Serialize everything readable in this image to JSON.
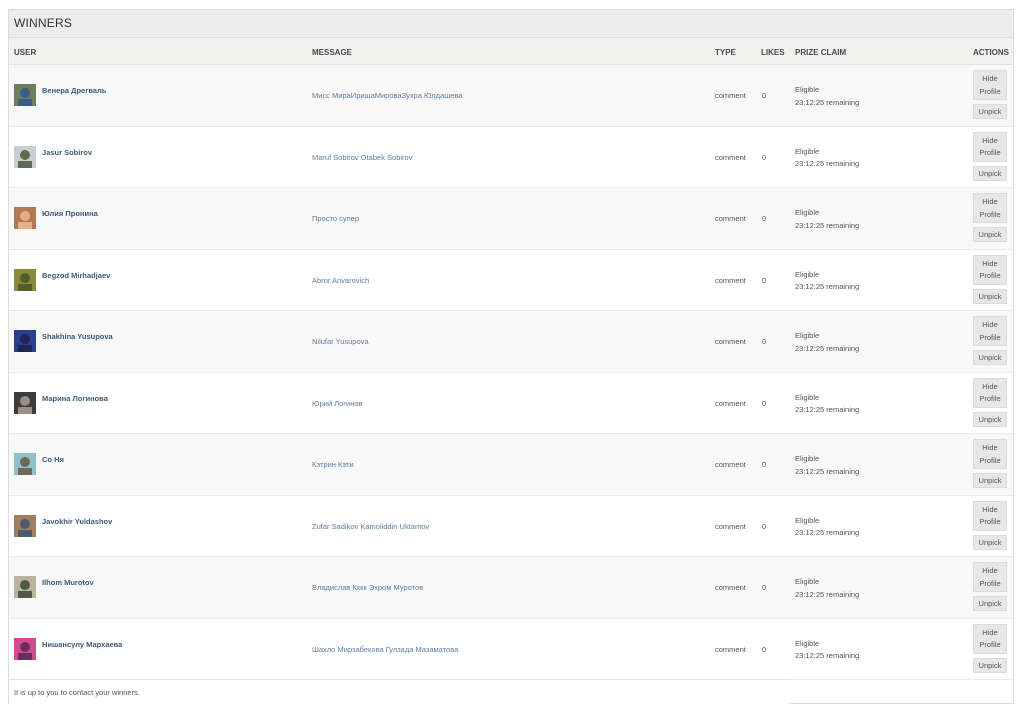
{
  "panel": {
    "title": "WINNERS"
  },
  "columns": {
    "user": "USER",
    "message": "MESSAGE",
    "type": "TYPE",
    "likes": "LIKES",
    "prize_claim": "PRIZE CLAIM",
    "actions": "ACTIONS"
  },
  "buttons": {
    "hide_line1": "Hide",
    "hide_line2": "Profile",
    "unpick": "Unpick"
  },
  "rows": [
    {
      "user": "Венера Дрегваль",
      "message": "Мисс МираИришаМироваЗухра Юлдашева",
      "type": "comment",
      "likes": "0",
      "status": "Eligible",
      "remaining": "23:12:25 remaining",
      "avatar_colors": [
        "#6a7f5a",
        "#3b5e86"
      ]
    },
    {
      "user": "Jasur Sobirov",
      "message": "Maruf Sobirov Otabek Sobirov",
      "type": "comment",
      "likes": "0",
      "status": "Eligible",
      "remaining": "23:12:25 remaining",
      "avatar_colors": [
        "#c9ced2",
        "#5e6a52"
      ]
    },
    {
      "user": "Юлия Пронина",
      "message": "Просто супер",
      "type": "comment",
      "likes": "0",
      "status": "Eligible",
      "remaining": "23:12:25 remaining",
      "avatar_colors": [
        "#b57852",
        "#e2b18a"
      ]
    },
    {
      "user": "Begzod Mirhadjaev",
      "message": "Abror Anvarovich",
      "type": "comment",
      "likes": "0",
      "status": "Eligible",
      "remaining": "23:12:25 remaining",
      "avatar_colors": [
        "#8c8a3a",
        "#4f5e2e"
      ]
    },
    {
      "user": "Shakhina Yusupova",
      "message": "Nilufar Yusupova",
      "type": "comment",
      "likes": "0",
      "status": "Eligible",
      "remaining": "23:12:25 remaining",
      "avatar_colors": [
        "#2c3f8a",
        "#1c2652"
      ]
    },
    {
      "user": "Марина Логинова",
      "message": "Юрий Логинов",
      "type": "comment",
      "likes": "0",
      "status": "Eligible",
      "remaining": "23:12:25 remaining",
      "avatar_colors": [
        "#3c3c3c",
        "#9a8f82"
      ]
    },
    {
      "user": "Со Ня",
      "message": "Кэтрин Кэти",
      "type": "comment",
      "likes": "0",
      "status": "Eligible",
      "remaining": "23:12:25 remaining",
      "avatar_colors": [
        "#8ec1c9",
        "#6e6a5a"
      ]
    },
    {
      "user": "Javokhir Yuldashov",
      "message": "Zufar Sadikov Kamoliddin Uktamov",
      "type": "comment",
      "likes": "0",
      "status": "Eligible",
      "remaining": "23:12:25 remaining",
      "avatar_colors": [
        "#a08060",
        "#4d5a6b"
      ]
    },
    {
      "user": "Ilhom Murotov",
      "message": "Владислав Кккк Эхром Муротов",
      "type": "comment",
      "likes": "0",
      "status": "Eligible",
      "remaining": "23:12:25 remaining",
      "avatar_colors": [
        "#b9b3a0",
        "#4e5a44"
      ]
    },
    {
      "user": "Нишансулу Мархаева",
      "message": "Шахло Мирзабекова Гулзада Мазаматова",
      "type": "comment",
      "likes": "0",
      "status": "Eligible",
      "remaining": "23:12:25 remaining",
      "avatar_colors": [
        "#d24b8e",
        "#6b2e5e"
      ]
    }
  ],
  "footer": {
    "text": "It is up to you to contact your winners."
  },
  "colors": {
    "username": "#3d5a7a",
    "message_link": "#5c7da0",
    "header_bg": "#ececec"
  }
}
